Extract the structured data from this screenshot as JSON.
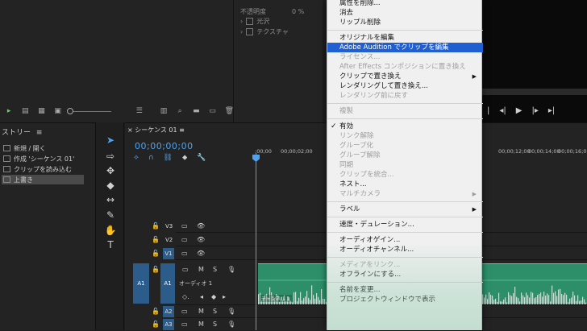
{
  "effects_panel": {
    "opacity_label": "不透明度",
    "opacity_value": "0 %",
    "rows": [
      "光沢",
      "テクスチャ"
    ]
  },
  "history": {
    "title": "ストリー",
    "menu_icon": "hamburger-icon",
    "items": [
      {
        "label": "新規 / 開く",
        "selected": false
      },
      {
        "label": "作成 'シーケンス 01'",
        "selected": false
      },
      {
        "label": "クリップを読み込む",
        "selected": false
      },
      {
        "label": "上書き",
        "selected": true
      }
    ]
  },
  "timeline": {
    "tab_label": "シーケンス 01",
    "timecode": "00;00;00;00",
    "ruler": [
      ":00;00",
      "00;00;02;00",
      "00;00;12;00",
      "00;00;14;00",
      "00;00;16;00"
    ],
    "video_tracks": [
      "V3",
      "V2",
      "V1"
    ],
    "audio_tracks": [
      "A1",
      "A2",
      "A3"
    ],
    "a1_target": "A1",
    "a1_source": "A1",
    "audio_track_name": "オーディオ 1",
    "mute_label": "M",
    "solo_label": "S",
    "clip_label": "チャンネル 1",
    "accent_color": "#4ea2f0",
    "clip_color": "#2d8f6a"
  },
  "context_menu": {
    "items": [
      {
        "label": "属性を削除...",
        "state": "enabled"
      },
      {
        "label": "消去",
        "state": "enabled"
      },
      {
        "label": "リップル削除",
        "state": "enabled"
      },
      {
        "separator": true
      },
      {
        "label": "オリジナルを編集",
        "state": "enabled"
      },
      {
        "label": "Adobe Audition でクリップを編集",
        "state": "highlighted"
      },
      {
        "label": "ライセンス...",
        "state": "disabled"
      },
      {
        "label": "After Effects コンポジションに置き換え",
        "state": "disabled"
      },
      {
        "label": "クリップで置き換え",
        "state": "enabled",
        "submenu": true
      },
      {
        "label": "レンダリングして置き換え...",
        "state": "enabled"
      },
      {
        "label": "レンダリング前に戻す",
        "state": "disabled"
      },
      {
        "separator": true
      },
      {
        "label": "複製",
        "state": "disabled"
      },
      {
        "separator": true
      },
      {
        "label": "有効",
        "state": "enabled",
        "checked": true
      },
      {
        "label": "リンク解除",
        "state": "disabled"
      },
      {
        "label": "グループ化",
        "state": "disabled"
      },
      {
        "label": "グループ解除",
        "state": "disabled"
      },
      {
        "label": "同期",
        "state": "disabled"
      },
      {
        "label": "クリップを統合...",
        "state": "disabled"
      },
      {
        "label": "ネスト...",
        "state": "enabled"
      },
      {
        "label": "マルチカメラ",
        "state": "disabled",
        "submenu": true
      },
      {
        "separator": true
      },
      {
        "label": "ラベル",
        "state": "enabled",
        "submenu": true
      },
      {
        "separator": true
      },
      {
        "label": "速度・デュレーション...",
        "state": "enabled"
      },
      {
        "separator": true
      },
      {
        "label": "オーディオゲイン...",
        "state": "enabled"
      },
      {
        "label": "オーディオチャンネル...",
        "state": "enabled"
      },
      {
        "separator": true
      },
      {
        "label": "メディアをリンク...",
        "state": "disabled"
      },
      {
        "label": "オフラインにする...",
        "state": "enabled"
      },
      {
        "separator": true
      },
      {
        "label": "名前を変更...",
        "state": "enabled"
      },
      {
        "label": "プロジェクトウィンドウで表示",
        "state": "enabled"
      }
    ]
  }
}
